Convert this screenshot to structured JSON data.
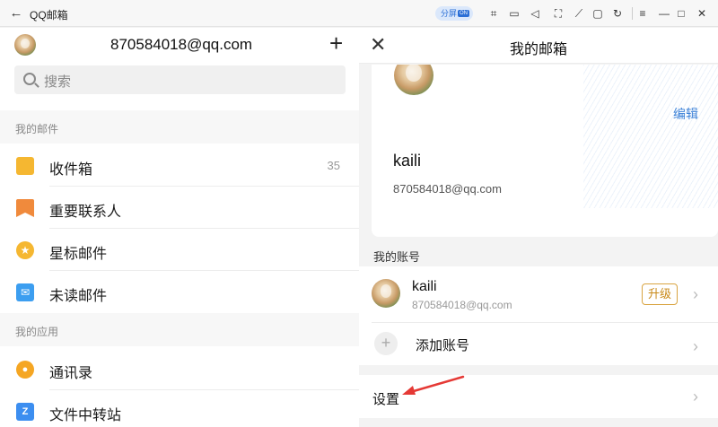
{
  "titlebar": {
    "title": "QQ邮箱",
    "split_label": "分屏",
    "split_badge": "ON",
    "icons": [
      "back-arrow-icon",
      "crop-icon",
      "video-icon",
      "volume-icon",
      "fullscreen-icon",
      "pin-icon",
      "folder-icon",
      "rotate-icon",
      "menu-icon",
      "minimize-icon",
      "maximize-icon",
      "close-icon"
    ]
  },
  "left": {
    "account_email": "870584018@qq.com",
    "search_placeholder": "搜索",
    "section_mail": "我的邮件",
    "mail_items": [
      {
        "label": "收件箱",
        "count": "35",
        "icon": "inbox-icon",
        "color": "#f5b731"
      },
      {
        "label": "重要联系人",
        "count": "",
        "icon": "bookmark-icon",
        "color": "#f08a3c"
      },
      {
        "label": "星标邮件",
        "count": "",
        "icon": "star-icon",
        "color": "#f5b731"
      },
      {
        "label": "未读邮件",
        "count": "",
        "icon": "unread-mail-icon",
        "color": "#3c9ef0"
      }
    ],
    "section_apps": "我的应用",
    "app_items": [
      {
        "label": "通讯录",
        "icon": "contacts-icon",
        "color": "#f5a623"
      },
      {
        "label": "文件中转站",
        "icon": "file-transfer-icon",
        "color": "#3c8ef0"
      }
    ]
  },
  "right": {
    "title": "我的邮箱",
    "edit": "编辑",
    "profile_name": "kaili",
    "profile_email": "870584018@qq.com",
    "accounts_label": "我的账号",
    "account_name": "kaili",
    "account_email": "870584018@qq.com",
    "upgrade": "升级",
    "add_account": "添加账号",
    "settings": "设置",
    "arrow_color": "#e53935"
  }
}
